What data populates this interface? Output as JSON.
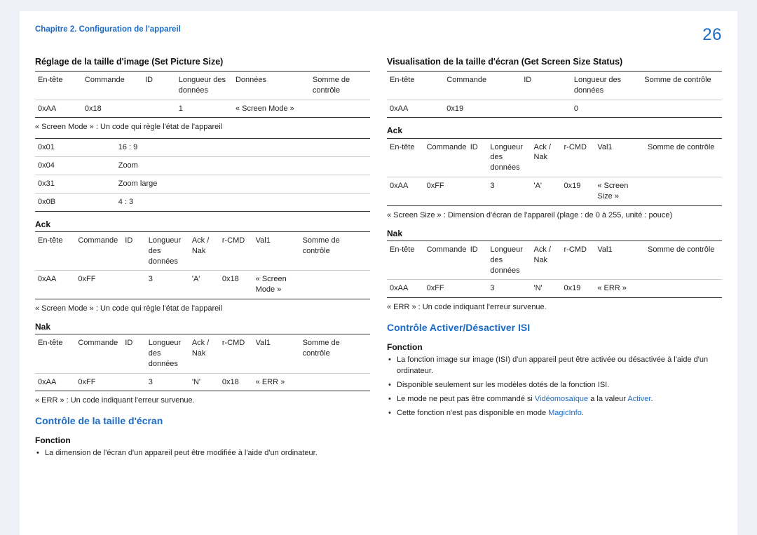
{
  "header": {
    "chapter": "Chapitre 2. Configuration de l'appareil",
    "page": "26"
  },
  "left": {
    "set_size_title": "Réglage de la taille d'image (Set Picture Size)",
    "set_size_hdr": [
      "En-tête",
      "Commande",
      "ID",
      "Longueur des données",
      "Données",
      "Somme de contrôle"
    ],
    "set_size_row": [
      "0xAA",
      "0x18",
      "",
      "1",
      "« Screen Mode »",
      ""
    ],
    "set_size_note": "« Screen Mode » : Un code qui règle l'état de l'appareil",
    "modes": [
      [
        "0x01",
        "16 : 9"
      ],
      [
        "0x04",
        "Zoom"
      ],
      [
        "0x31",
        "Zoom large"
      ],
      [
        "0x0B",
        "4 : 3"
      ]
    ],
    "ack_label": "Ack",
    "ack_hdr": [
      "En-tête",
      "Commande",
      "ID",
      "Longueur des données",
      "Ack / Nak",
      "r-CMD",
      "Val1",
      "Somme de contrôle"
    ],
    "ack_row": [
      "0xAA",
      "0xFF",
      "",
      "3",
      "'A'",
      "0x18",
      "« Screen Mode »",
      ""
    ],
    "ack_note": "« Screen Mode » : Un code qui règle l'état de l'appareil",
    "nak_label": "Nak",
    "nak_hdr": [
      "En-tête",
      "Commande",
      "ID",
      "Longueur des données",
      "Ack / Nak",
      "r-CMD",
      "Val1",
      "Somme de contrôle"
    ],
    "nak_row": [
      "0xAA",
      "0xFF",
      "",
      "3",
      "'N'",
      "0x18",
      "« ERR »",
      ""
    ],
    "nak_note": "« ERR » : Un code indiquant l'erreur survenue.",
    "screen_ctrl_title": "Contrôle de la taille d'écran",
    "fonction_label": "Fonction",
    "fonction_bullet": "La dimension de l'écran d'un appareil peut être modifiée à l'aide d'un ordinateur."
  },
  "right": {
    "get_size_title": "Visualisation de la taille d'écran (Get Screen Size Status)",
    "get_size_hdr": [
      "En-tête",
      "Commande",
      "ID",
      "Longueur des données",
      "Somme de contrôle"
    ],
    "get_size_row": [
      "0xAA",
      "0x19",
      "",
      "0",
      ""
    ],
    "ack_label": "Ack",
    "ack_hdr": [
      "En-tête",
      "Commande",
      "ID",
      "Longueur des données",
      "Ack / Nak",
      "r-CMD",
      "Val1",
      "Somme de contrôle"
    ],
    "ack_row": [
      "0xAA",
      "0xFF",
      "",
      "3",
      "'A'",
      "0x19",
      "« Screen Size »",
      ""
    ],
    "ack_note": "« Screen Size » : Dimension d'écran de l'appareil (plage : de 0 à 255, unité : pouce)",
    "nak_label": "Nak",
    "nak_hdr": [
      "En-tête",
      "Commande",
      "ID",
      "Longueur des données",
      "Ack / Nak",
      "r-CMD",
      "Val1",
      "Somme de contrôle"
    ],
    "nak_row": [
      "0xAA",
      "0xFF",
      "",
      "3",
      "'N'",
      "0x19",
      "« ERR »",
      ""
    ],
    "nak_note": "« ERR » : Un code indiquant l'erreur survenue.",
    "isi_title": "Contrôle Activer/Désactiver ISI",
    "fonction_label": "Fonction",
    "bullets": {
      "b0": "La fonction image sur image (ISI) d'un appareil peut être activée ou désactivée à l'aide d'un ordinateur.",
      "b1": "Disponible seulement sur les modèles dotés de la fonction ISI.",
      "b2_pre": "Le mode ne peut pas être commandé si ",
      "b2_link1": "Vidéomosaïque",
      "b2_mid": " a la valeur ",
      "b2_link2": "Activer",
      "b2_post": ".",
      "b3_pre": "Cette fonction n'est pas disponible en mode ",
      "b3_link": "MagicInfo",
      "b3_post": "."
    }
  }
}
